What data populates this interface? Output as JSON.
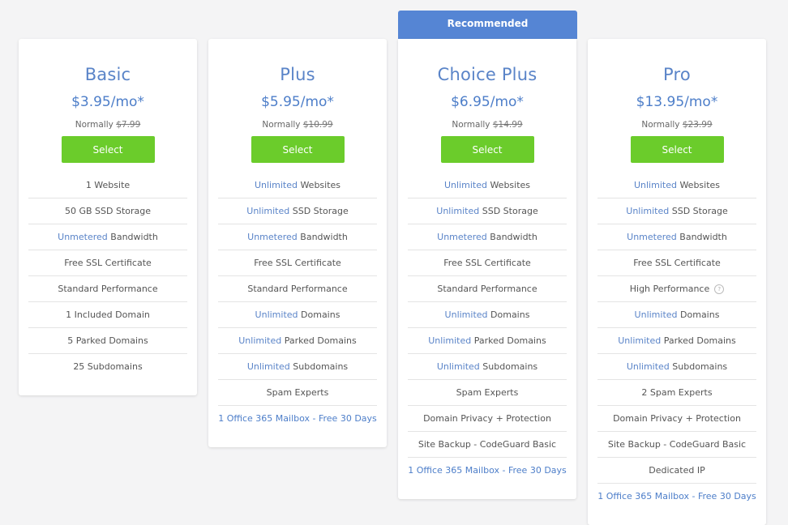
{
  "recommended_label": "Recommended",
  "plans": [
    {
      "name": "Basic",
      "price": "$3.95/mo*",
      "normally_label": "Normally",
      "normal_price": "$7.99",
      "select_label": "Select",
      "features": [
        {
          "hl": "",
          "text": "1 Website"
        },
        {
          "hl": "",
          "text": "50 GB SSD Storage"
        },
        {
          "hl": "Unmetered",
          "text": " Bandwidth"
        },
        {
          "hl": "",
          "text": "Free SSL Certificate"
        },
        {
          "hl": "",
          "text": "Standard Performance"
        },
        {
          "hl": "",
          "text": "1 Included Domain"
        },
        {
          "hl": "",
          "text": "5 Parked Domains"
        },
        {
          "hl": "",
          "text": "25 Subdomains"
        }
      ]
    },
    {
      "name": "Plus",
      "price": "$5.95/mo*",
      "normally_label": "Normally",
      "normal_price": "$10.99",
      "select_label": "Select",
      "features": [
        {
          "hl": "Unlimited",
          "text": " Websites"
        },
        {
          "hl": "Unlimited",
          "text": " SSD Storage"
        },
        {
          "hl": "Unmetered",
          "text": " Bandwidth"
        },
        {
          "hl": "",
          "text": "Free SSL Certificate"
        },
        {
          "hl": "",
          "text": "Standard Performance"
        },
        {
          "hl": "Unlimited",
          "text": " Domains"
        },
        {
          "hl": "Unlimited",
          "text": " Parked Domains"
        },
        {
          "hl": "Unlimited",
          "text": " Subdomains"
        },
        {
          "hl": "",
          "text": "Spam Experts"
        },
        {
          "hl": "",
          "text": "",
          "link": "1 Office 365 Mailbox - Free 30 Days"
        }
      ]
    },
    {
      "name": "Choice Plus",
      "price": "$6.95/mo*",
      "normally_label": "Normally",
      "normal_price": "$14.99",
      "select_label": "Select",
      "features": [
        {
          "hl": "Unlimited",
          "text": " Websites"
        },
        {
          "hl": "Unlimited",
          "text": " SSD Storage"
        },
        {
          "hl": "Unmetered",
          "text": " Bandwidth"
        },
        {
          "hl": "",
          "text": "Free SSL Certificate"
        },
        {
          "hl": "",
          "text": "Standard Performance"
        },
        {
          "hl": "Unlimited",
          "text": " Domains"
        },
        {
          "hl": "Unlimited",
          "text": " Parked Domains"
        },
        {
          "hl": "Unlimited",
          "text": " Subdomains"
        },
        {
          "hl": "",
          "text": "Spam Experts"
        },
        {
          "hl": "",
          "text": "Domain Privacy + Protection"
        },
        {
          "hl": "",
          "text": "Site Backup - CodeGuard Basic"
        },
        {
          "hl": "",
          "text": "",
          "link": "1 Office 365 Mailbox - Free 30 Days"
        }
      ]
    },
    {
      "name": "Pro",
      "price": "$13.95/mo*",
      "normally_label": "Normally",
      "normal_price": "$23.99",
      "select_label": "Select",
      "features": [
        {
          "hl": "Unlimited",
          "text": " Websites"
        },
        {
          "hl": "Unlimited",
          "text": " SSD Storage"
        },
        {
          "hl": "Unmetered",
          "text": " Bandwidth"
        },
        {
          "hl": "",
          "text": "Free SSL Certificate"
        },
        {
          "hl": "",
          "text": "High Performance",
          "help": "?"
        },
        {
          "hl": "Unlimited",
          "text": " Domains"
        },
        {
          "hl": "Unlimited",
          "text": " Parked Domains"
        },
        {
          "hl": "Unlimited",
          "text": " Subdomains"
        },
        {
          "hl": "",
          "text": "2 Spam Experts"
        },
        {
          "hl": "",
          "text": "Domain Privacy + Protection"
        },
        {
          "hl": "",
          "text": "Site Backup - CodeGuard Basic"
        },
        {
          "hl": "",
          "text": "Dedicated IP"
        },
        {
          "hl": "",
          "text": "",
          "link": "1 Office 365 Mailbox - Free 30 Days"
        }
      ]
    }
  ]
}
